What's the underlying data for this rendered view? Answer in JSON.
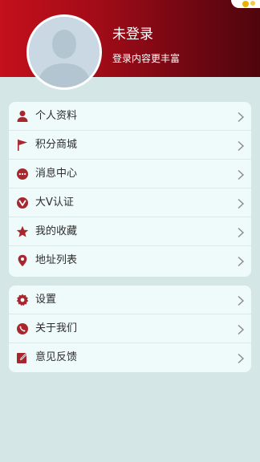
{
  "profile": {
    "title": "未登录",
    "subtitle": "登录内容更丰富"
  },
  "colors": {
    "header_start": "#c3101c",
    "header_end": "#50050d",
    "icon": "#a8272f",
    "background": "#d4e7e6",
    "card": "#effafa"
  },
  "menu_main": [
    {
      "label": "个人资料",
      "icon": "person-icon"
    },
    {
      "label": "积分商城",
      "icon": "flag-icon"
    },
    {
      "label": "消息中心",
      "icon": "chat-bubble-icon"
    },
    {
      "label": "大V认证",
      "icon": "verified-check-icon"
    },
    {
      "label": "我的收藏",
      "icon": "star-icon"
    },
    {
      "label": "地址列表",
      "icon": "location-pin-icon"
    }
  ],
  "menu_settings": [
    {
      "label": "设置",
      "icon": "gear-icon"
    },
    {
      "label": "关于我们",
      "icon": "phone-icon"
    },
    {
      "label": "意见反馈",
      "icon": "edit-icon"
    }
  ]
}
